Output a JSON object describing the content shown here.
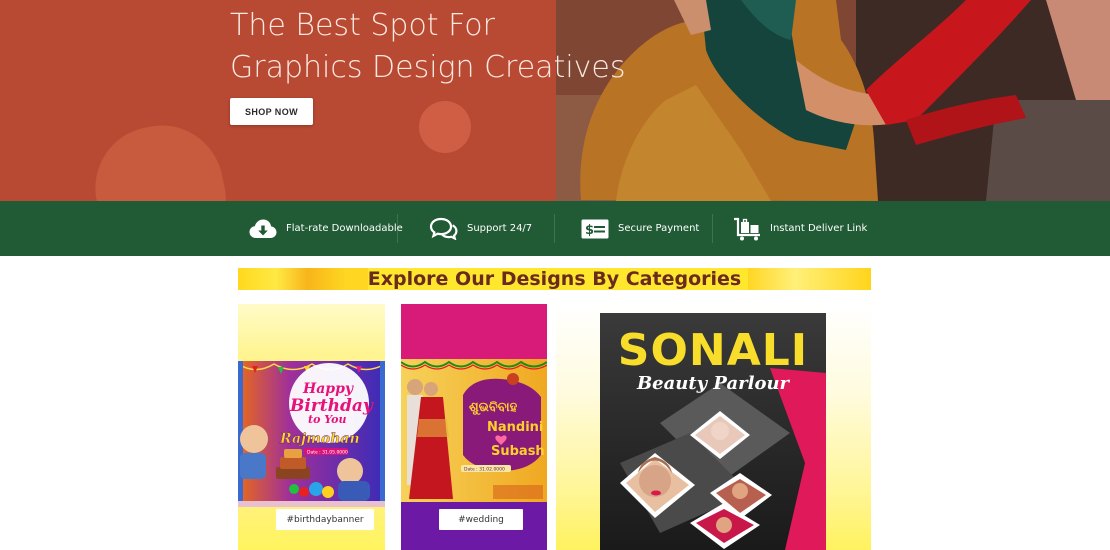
{
  "hero": {
    "title_line1": "The Best Spot For",
    "title_line2": "Graphics Design Creatives",
    "shop_button": "SHOP NOW",
    "colors": {
      "left_panel": "#b84a33",
      "title": "#fbe9e2"
    }
  },
  "features": {
    "background": "#215b36",
    "items": [
      {
        "label": "Flat-rate Downloadable",
        "icon": "cloud-download-icon"
      },
      {
        "label": "Support 24/7",
        "icon": "chat-bubbles-icon"
      },
      {
        "label": "Secure Payment",
        "icon": "payment-card-icon"
      },
      {
        "label": "Instant Deliver Link",
        "icon": "luggage-cart-icon"
      }
    ]
  },
  "categories": {
    "title": "Explore Our Designs By Categories",
    "cards": [
      {
        "tag": "#birthdaybanner",
        "banner": {
          "line1": "Happy",
          "line2": "Birthday",
          "line3": "to You",
          "name": "Rajmohan",
          "date": "Date : 31.05.0000"
        }
      },
      {
        "tag": "#wedding",
        "banner": {
          "name1": "Nandini",
          "name2": "Subash",
          "date": "Date : 31.02.0000"
        }
      },
      {
        "tag": "",
        "banner": {
          "title": "SONALI",
          "subtitle": "Beauty Parlour"
        }
      }
    ]
  }
}
